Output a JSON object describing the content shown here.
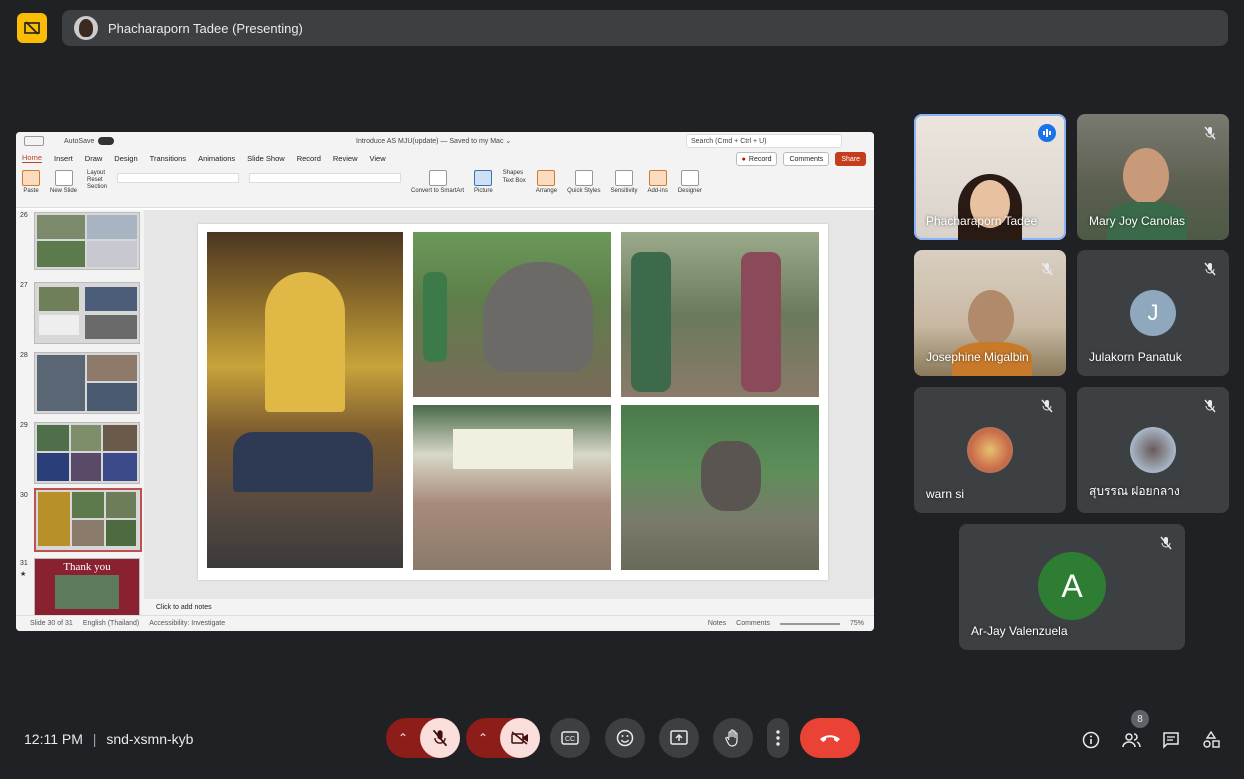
{
  "top_bar": {
    "presenter_title": "Phacharaporn Tadee (Presenting)"
  },
  "presentation": {
    "autosave_label": "AutoSave",
    "doc_title": "Introduce AS MJU(update) — Saved to my Mac ⌄",
    "search_placeholder": "Search (Cmd + Ctrl + U)",
    "tabs": [
      "Home",
      "Insert",
      "Draw",
      "Design",
      "Transitions",
      "Animations",
      "Slide Show",
      "Record",
      "Review",
      "View"
    ],
    "record_label": "Record",
    "comments_label": "Comments",
    "share_label": "Share",
    "ribbon": {
      "paste": "Paste",
      "new_slide": "New Slide",
      "layout": "Layout",
      "reset": "Reset",
      "section": "Section",
      "convert": "Convert to SmartArt",
      "picture": "Picture",
      "shapes": "Shapes",
      "text_box": "Text Box",
      "arrange": "Arrange",
      "quick_styles": "Quick Styles",
      "sensitivity": "Sensitivity",
      "addins": "Add-ins",
      "designer": "Designer"
    },
    "thumb_numbers": [
      "26",
      "27",
      "28",
      "29",
      "30",
      "31"
    ],
    "thank_you": "Thank you",
    "notes_placeholder": "Click to add notes",
    "status_slide": "Slide 30 of 31",
    "status_lang": "English (Thailand)",
    "status_access": "Accessibility: Investigate",
    "status_notes": "Notes",
    "status_comments": "Comments",
    "zoom": "75%"
  },
  "participants": [
    {
      "name": "Phacharaporn Tadee",
      "speaking": true
    },
    {
      "name": "Mary Joy Canolas",
      "muted": true
    },
    {
      "name": "Josephine Migalbin",
      "muted": true
    },
    {
      "name": "Julakorn Panatuk",
      "initial": "J",
      "muted": true
    },
    {
      "name": "warn si",
      "muted": true
    },
    {
      "name": "สุบรรณ ฝอยกลาง",
      "muted": true
    },
    {
      "name": "Ar-Jay Valenzuela",
      "initial": "A",
      "muted": true
    }
  ],
  "bottom_bar": {
    "time": "12:11 PM",
    "separator": "|",
    "meeting_code": "snd-xsmn-kyb",
    "people_count": "8"
  },
  "colors": {
    "background": "#202124",
    "tile": "#3c4043",
    "end_call": "#ea4335",
    "present_badge": "#fbbc04",
    "avatar_j": "#8fa8bd",
    "avatar_a": "#2e7d32"
  },
  "icons": [
    "present-icon",
    "mic-off-icon",
    "camera-off-icon",
    "captions-icon",
    "emoji-icon",
    "present-screen-icon",
    "raise-hand-icon",
    "more-options-icon",
    "end-call-icon",
    "info-icon",
    "people-icon",
    "chat-icon",
    "activities-icon",
    "speaking-icon"
  ]
}
